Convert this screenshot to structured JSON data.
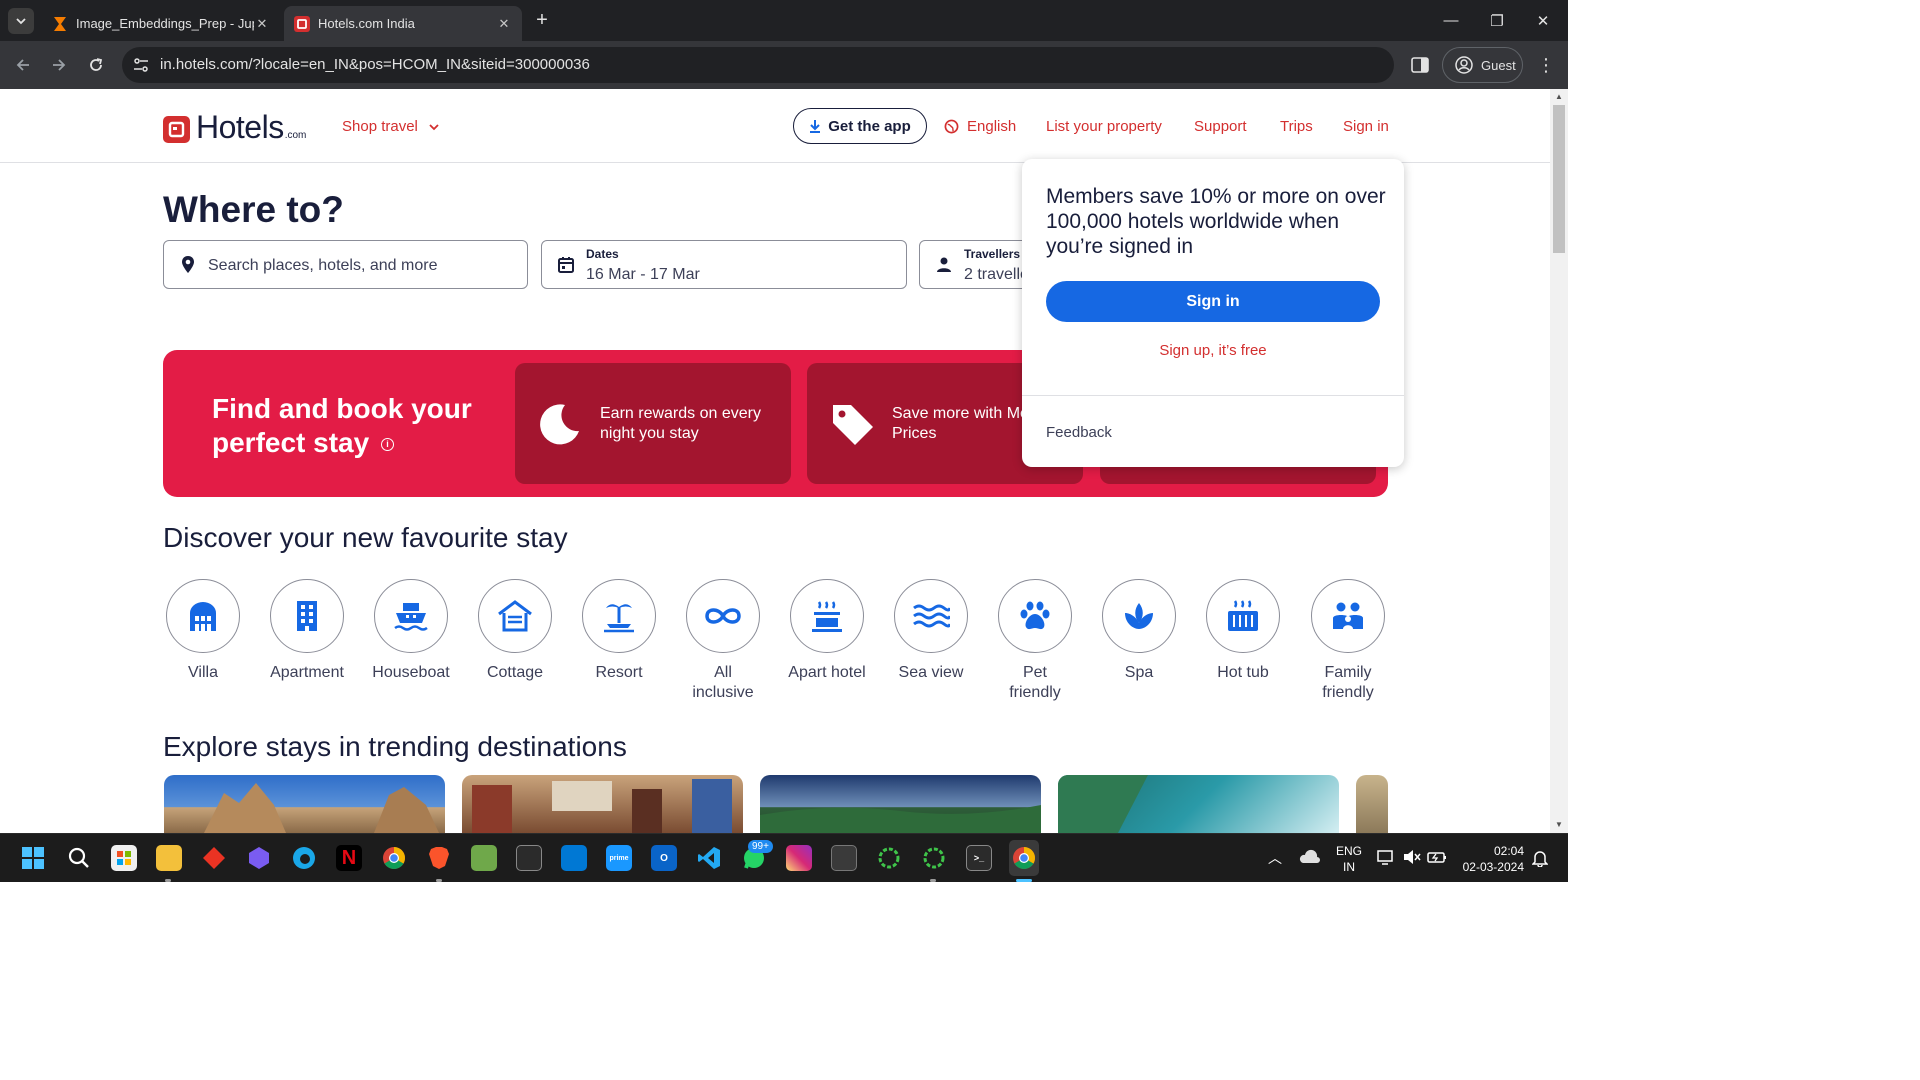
{
  "browser": {
    "tabs": [
      {
        "title": "Image_Embeddings_Prep - Jupy",
        "favicon": "hourglass-icon"
      },
      {
        "title": "Hotels.com India",
        "favicon": "hotels-icon",
        "active": true
      }
    ],
    "url": "in.hotels.com/?locale=en_IN&pos=HCOM_IN&siteid=300000036",
    "profile": "Guest"
  },
  "header": {
    "logo_word": "Hotels",
    "logo_suffix": ".com",
    "shop_travel": "Shop travel",
    "get_app": "Get the app",
    "language": "English",
    "list_property": "List your property",
    "support": "Support",
    "trips": "Trips",
    "sign_in": "Sign in"
  },
  "search": {
    "title": "Where to?",
    "destination_placeholder": "Search places, hotels, and more",
    "dates_label": "Dates",
    "dates_value": "16 Mar - 17 Mar",
    "travellers_label": "Travellers",
    "travellers_value": "2 travellers, 1 room"
  },
  "banner": {
    "headline": "Find and book your perfect stay",
    "cards": [
      {
        "text": "Earn rewards on every night you stay",
        "icon": "moon-icon"
      },
      {
        "text": "Save more with Member Prices",
        "icon": "tag-icon"
      }
    ]
  },
  "signin_popup": {
    "message": "Members save 10% or more on over 100,000 hotels worldwide when you’re signed in",
    "sign_in_button": "Sign in",
    "sign_up": "Sign up, it’s free",
    "feedback": "Feedback"
  },
  "discover": {
    "title": "Discover your new favourite stay",
    "items": [
      {
        "label": "Villa",
        "icon": "villa-icon"
      },
      {
        "label": "Apartment",
        "icon": "apartment-icon"
      },
      {
        "label": "Houseboat",
        "icon": "houseboat-icon"
      },
      {
        "label": "Cottage",
        "icon": "cottage-icon"
      },
      {
        "label": "Resort",
        "icon": "resort-icon"
      },
      {
        "label": "All inclusive",
        "icon": "all-inclusive-icon"
      },
      {
        "label": "Apart hotel",
        "icon": "apart-hotel-icon"
      },
      {
        "label": "Sea view",
        "icon": "sea-view-icon"
      },
      {
        "label": "Pet friendly",
        "icon": "paw-icon"
      },
      {
        "label": "Spa",
        "icon": "spa-icon"
      },
      {
        "label": "Hot tub",
        "icon": "hot-tub-icon"
      },
      {
        "label": "Family friendly",
        "icon": "family-icon"
      }
    ]
  },
  "trending": {
    "title": "Explore stays in trending destinations"
  },
  "taskbar": {
    "language": "ENG",
    "region": "IN",
    "time": "02:04",
    "date": "02-03-2024",
    "whatsapp_badge": "99+"
  },
  "colors": {
    "brand_red": "#d32f2f",
    "banner_red": "#e31c46",
    "banner_card": "#a3152f",
    "icon_blue": "#1668e3"
  }
}
